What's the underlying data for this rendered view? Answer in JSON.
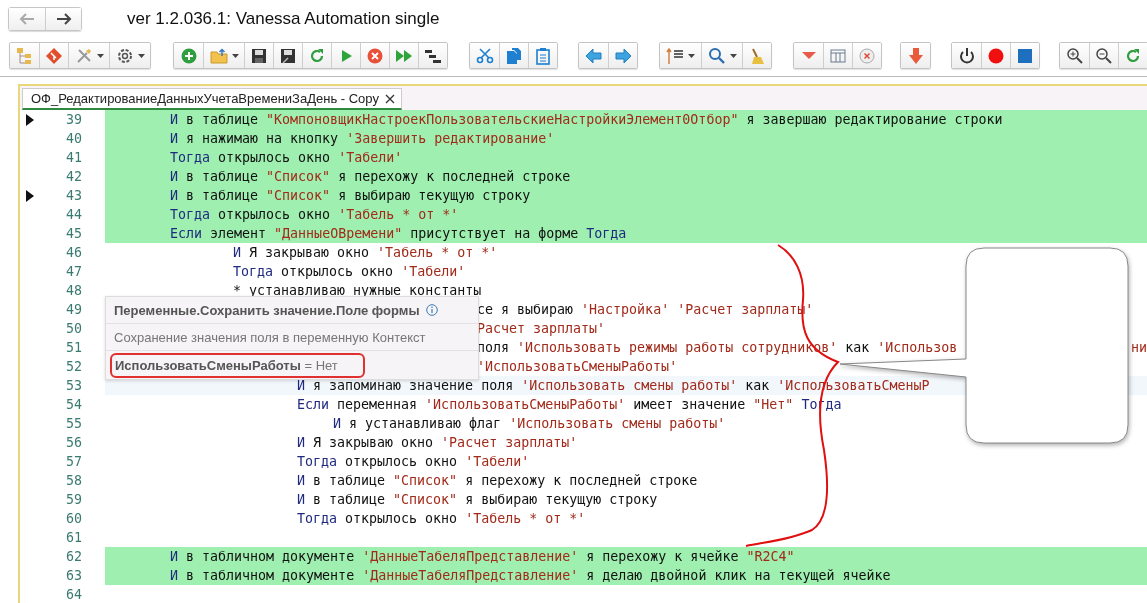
{
  "window": {
    "title": "ver 1.2.036.1: Vanessa Automation single"
  },
  "tabs": [
    {
      "label": "ОФ_РедактированиеДанныхУчетаВремениЗаДень - Copy",
      "selected": true
    }
  ],
  "lines": [
    {
      "number": "39",
      "marker": true,
      "highlighted": true,
      "tokens": [
        {
          "kind": "keyword",
          "text": "И"
        },
        {
          "kind": "text",
          "text": " в таблице "
        },
        {
          "kind": "string",
          "text": "\"КомпоновщикНастроекПользовательскиеНастройкиЭлемент0Отбор\""
        },
        {
          "kind": "text",
          "text": " я завершаю редактирование строки"
        }
      ]
    },
    {
      "number": "40",
      "marker": false,
      "highlighted": true,
      "tokens": [
        {
          "kind": "keyword",
          "text": "И"
        },
        {
          "kind": "text",
          "text": " я нажимаю на кнопку "
        },
        {
          "kind": "string",
          "text": "'Завершить редактирование'"
        }
      ]
    },
    {
      "number": "41",
      "marker": false,
      "highlighted": true,
      "tokens": [
        {
          "kind": "keyword",
          "text": "Тогда"
        },
        {
          "kind": "text",
          "text": " открылось окно "
        },
        {
          "kind": "string",
          "text": "'Табели'"
        }
      ]
    },
    {
      "number": "42",
      "marker": false,
      "highlighted": true,
      "tokens": [
        {
          "kind": "keyword",
          "text": "И"
        },
        {
          "kind": "text",
          "text": " в таблице "
        },
        {
          "kind": "string",
          "text": "\"Список\""
        },
        {
          "kind": "text",
          "text": " я перехожу к последней строке"
        }
      ]
    },
    {
      "number": "43",
      "marker": true,
      "highlighted": true,
      "tokens": [
        {
          "kind": "keyword",
          "text": "И"
        },
        {
          "kind": "text",
          "text": " в таблице "
        },
        {
          "kind": "string",
          "text": "\"Список\""
        },
        {
          "kind": "text",
          "text": " я выбираю текущую строку"
        }
      ]
    },
    {
      "number": "44",
      "marker": false,
      "highlighted": true,
      "tokens": [
        {
          "kind": "keyword",
          "text": "Тогда"
        },
        {
          "kind": "text",
          "text": " открылось окно "
        },
        {
          "kind": "string",
          "text": "'Табель * от *'"
        }
      ]
    },
    {
      "number": "45",
      "marker": false,
      "highlighted": true,
      "tokens": [
        {
          "kind": "keyword",
          "text": "Если"
        },
        {
          "kind": "text",
          "text": " элемент "
        },
        {
          "kind": "string",
          "text": "\"ДанныеОВремени\""
        },
        {
          "kind": "text",
          "text": " присутствует на форме "
        },
        {
          "kind": "keyword",
          "text": "Тогда"
        }
      ],
      "children": [
        {
          "number": "46",
          "marker": false,
          "highlighted": false,
          "tokens": [
            {
              "kind": "keyword",
              "text": "И"
            },
            {
              "kind": "text",
              "text": " Я закрываю окно "
            },
            {
              "kind": "string",
              "text": "'Табель * от *'"
            }
          ]
        },
        {
          "number": "47",
          "marker": false,
          "highlighted": false,
          "tokens": [
            {
              "kind": "keyword",
              "text": "Тогда"
            },
            {
              "kind": "text",
              "text": " открылось окно "
            },
            {
              "kind": "string",
              "text": "'Табели'"
            }
          ]
        },
        {
          "number": "48",
          "marker": false,
          "highlighted": false,
          "tokens": [
            {
              "kind": "text",
              "text": "* устанавливаю нужные константы"
            }
          ],
          "children": [
            {
              "number": "49",
              "marker": false,
              "highlighted": false,
              "behind_popup": true,
              "tokens": [
                {
                  "kind": "text",
                  "text": "се я выбираю "
                },
                {
                  "kind": "string",
                  "text": "'Настройка' "
                },
                {
                  "kind": "string",
                  "text": "'Расчет зарплаты'"
                }
              ]
            },
            {
              "number": "50",
              "marker": false,
              "highlighted": false,
              "behind_popup": true,
              "tokens": [
                {
                  "kind": "string",
                  "text": "Расчет зарплаты'"
                }
              ]
            },
            {
              "number": "51",
              "marker": false,
              "highlighted": false,
              "behind_popup": true,
              "tokens": [
                {
                  "kind": "text",
                  "text": "поля "
                },
                {
                  "kind": "string",
                  "text": "'Использовать режимы работы сотрудников'"
                },
                {
                  "kind": "text",
                  "text": " как "
                },
                {
                  "kind": "string",
                  "text": "'Использов"
                }
              ],
              "tail": "ни"
            },
            {
              "number": "52",
              "marker": false,
              "highlighted": false,
              "behind_popup": true,
              "tokens": [
                {
                  "kind": "string",
                  "text": "'ИспользоватьСменыРаботы'"
                }
              ]
            },
            {
              "number": "53",
              "marker": false,
              "highlighted": false,
              "current": true,
              "tokens": [
                {
                  "kind": "keyword",
                  "text": "И"
                },
                {
                  "kind": "text",
                  "text": " я запоминаю значение поля "
                },
                {
                  "kind": "string",
                  "text": "'Использовать смены работы'"
                },
                {
                  "kind": "text",
                  "text": " как "
                },
                {
                  "kind": "string",
                  "text": "'ИспользоватьСменыР"
                }
              ]
            },
            {
              "number": "54",
              "marker": false,
              "highlighted": false,
              "tokens": [
                {
                  "kind": "keyword",
                  "text": "Если"
                },
                {
                  "kind": "text",
                  "text": " переменная "
                },
                {
                  "kind": "string",
                  "text": "'ИспользоватьСменыРаботы'"
                },
                {
                  "kind": "text",
                  "text": " имеет значение "
                },
                {
                  "kind": "string",
                  "text": "\"Нет\" "
                },
                {
                  "kind": "keyword",
                  "text": "Тогда"
                }
              ],
              "children": [
                {
                  "number": "55",
                  "marker": false,
                  "highlighted": false,
                  "tokens": [
                    {
                      "kind": "keyword",
                      "text": "И"
                    },
                    {
                      "kind": "text",
                      "text": " я устанавливаю флаг "
                    },
                    {
                      "kind": "string",
                      "text": "'Использовать смены работы'"
                    }
                  ]
                }
              ]
            },
            {
              "number": "56",
              "marker": false,
              "highlighted": false,
              "tokens": [
                {
                  "kind": "keyword",
                  "text": "И"
                },
                {
                  "kind": "text",
                  "text": " Я закрываю окно "
                },
                {
                  "kind": "string",
                  "text": "'Расчет зарплаты'"
                }
              ]
            },
            {
              "number": "57",
              "marker": false,
              "highlighted": false,
              "tokens": [
                {
                  "kind": "keyword",
                  "text": "Тогда"
                },
                {
                  "kind": "text",
                  "text": " открылось окно "
                },
                {
                  "kind": "string",
                  "text": "'Табели'"
                }
              ]
            },
            {
              "number": "58",
              "marker": false,
              "highlighted": false,
              "tokens": [
                {
                  "kind": "keyword",
                  "text": "И"
                },
                {
                  "kind": "text",
                  "text": " в таблице "
                },
                {
                  "kind": "string",
                  "text": "\"Список\""
                },
                {
                  "kind": "text",
                  "text": " я перехожу к последней строке"
                }
              ]
            },
            {
              "number": "59",
              "marker": false,
              "highlighted": false,
              "tokens": [
                {
                  "kind": "keyword",
                  "text": "И"
                },
                {
                  "kind": "text",
                  "text": " в таблице "
                },
                {
                  "kind": "string",
                  "text": "\"Список\""
                },
                {
                  "kind": "text",
                  "text": " я выбираю текущую строку"
                }
              ]
            },
            {
              "number": "60",
              "marker": false,
              "highlighted": false,
              "tokens": [
                {
                  "kind": "keyword",
                  "text": "Тогда"
                },
                {
                  "kind": "text",
                  "text": " открылось окно "
                },
                {
                  "kind": "string",
                  "text": "'Табель * от *'"
                }
              ]
            }
          ]
        }
      ]
    },
    {
      "number": "61",
      "marker": false,
      "highlighted": false
    },
    {
      "number": "62",
      "marker": false,
      "highlighted": true,
      "tokens": [
        {
          "kind": "keyword",
          "text": "И"
        },
        {
          "kind": "text",
          "text": " в табличном документе "
        },
        {
          "kind": "string",
          "text": "'ДанныеТабеляПредставление'"
        },
        {
          "kind": "text",
          "text": " я перехожу к ячейке "
        },
        {
          "kind": "string",
          "text": "\"R2C4\""
        }
      ]
    },
    {
      "number": "63",
      "marker": false,
      "highlighted": true,
      "tokens": [
        {
          "kind": "keyword",
          "text": "И"
        },
        {
          "kind": "text",
          "text": " в табличном документе "
        },
        {
          "kind": "string",
          "text": "'ДанныеТабеляПредставление'"
        },
        {
          "kind": "text",
          "text": " я делаю двойной клик на текущей ячейке"
        }
      ]
    },
    {
      "number": "64",
      "marker": false,
      "highlighted": false
    }
  ],
  "popup": {
    "title": "Переменные.Сохранить значение.Поле формы",
    "description": "Сохранение значения поля в переменную Контекст",
    "value": "**ИспользоватьСменыРаботы** = Нет"
  }
}
